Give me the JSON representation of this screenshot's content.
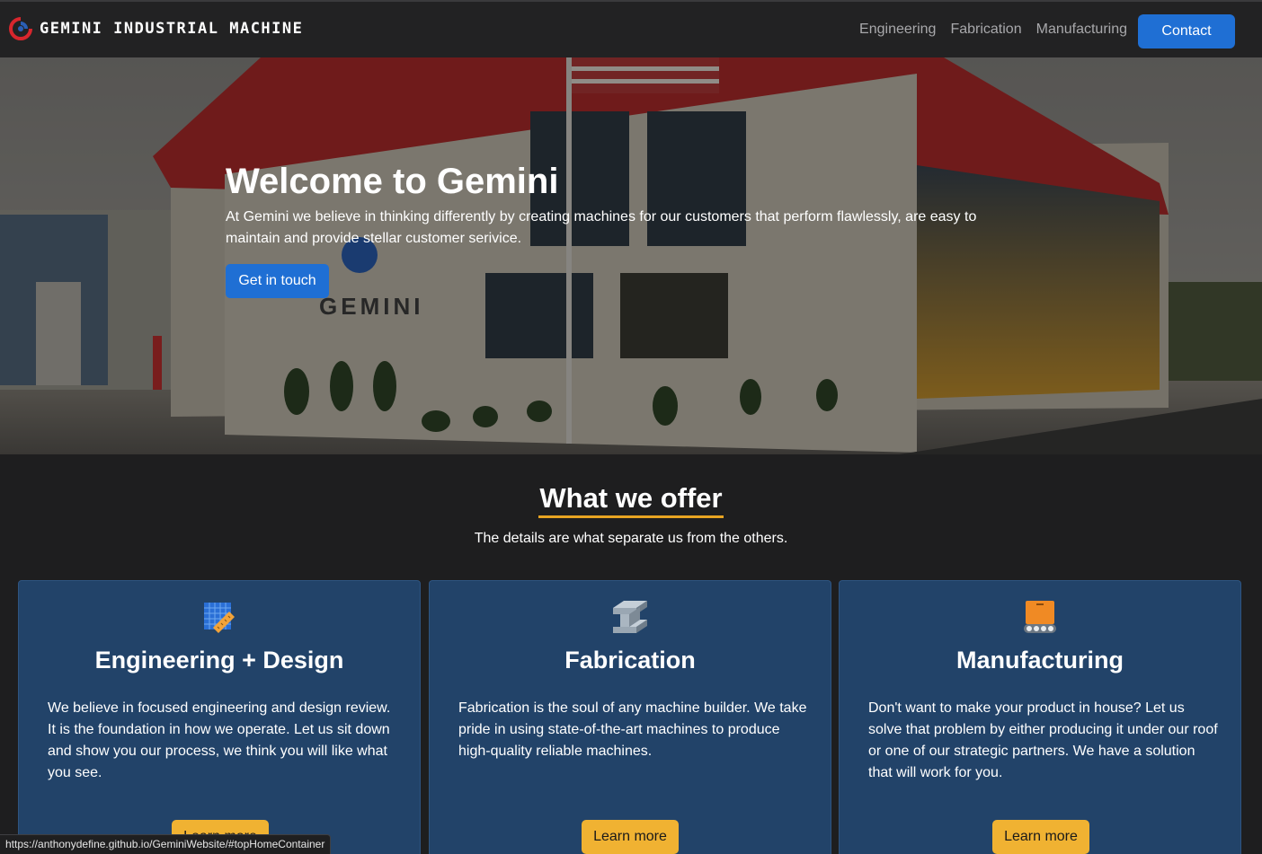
{
  "navbar": {
    "brand": "GEMINI INDUSTRIAL MACHINE",
    "links": [
      "Engineering",
      "Fabrication",
      "Manufacturing"
    ],
    "contact_label": "Contact"
  },
  "hero": {
    "title": "Welcome to Gemini",
    "text": "At Gemini we believe in thinking differently by creating machines for our customers that perform flawlessly, are easy to maintain and provide stellar customer serivice.",
    "button_label": "Get in touch",
    "sign_text": "GEMINI"
  },
  "offer": {
    "title": "What we offer",
    "subtitle": "The details are what separate us from the others."
  },
  "cards": [
    {
      "icon": "blueprint-ruler-icon",
      "title": "Engineering + Design",
      "text": "We believe in focused engineering and design review. It is the foundation in how we operate. Let us sit down and show you our process, we think you will like what you see.",
      "button_label": "Learn more"
    },
    {
      "icon": "steel-i-beam-icon",
      "title": "Fabrication",
      "text": "Fabrication is the soul of any machine builder. We take pride in using state-of-the-art machines to produce high-quality reliable machines.",
      "button_label": "Learn more"
    },
    {
      "icon": "conveyor-box-icon",
      "title": "Manufacturing",
      "text": "Don't want to make your product in house? Let us solve that problem by either producing it under our roof or one of our strategic partners. We have a solution that will work for you.",
      "button_label": "Learn more"
    }
  ],
  "status_bar": {
    "url": "https://anthonydefine.github.io/GeminiWebsite/#topHomeContainer"
  },
  "colors": {
    "primary_blue": "#1f6fd4",
    "accent_yellow": "#f0b232",
    "card_blue": "#224369",
    "background": "#1e1e1f"
  }
}
